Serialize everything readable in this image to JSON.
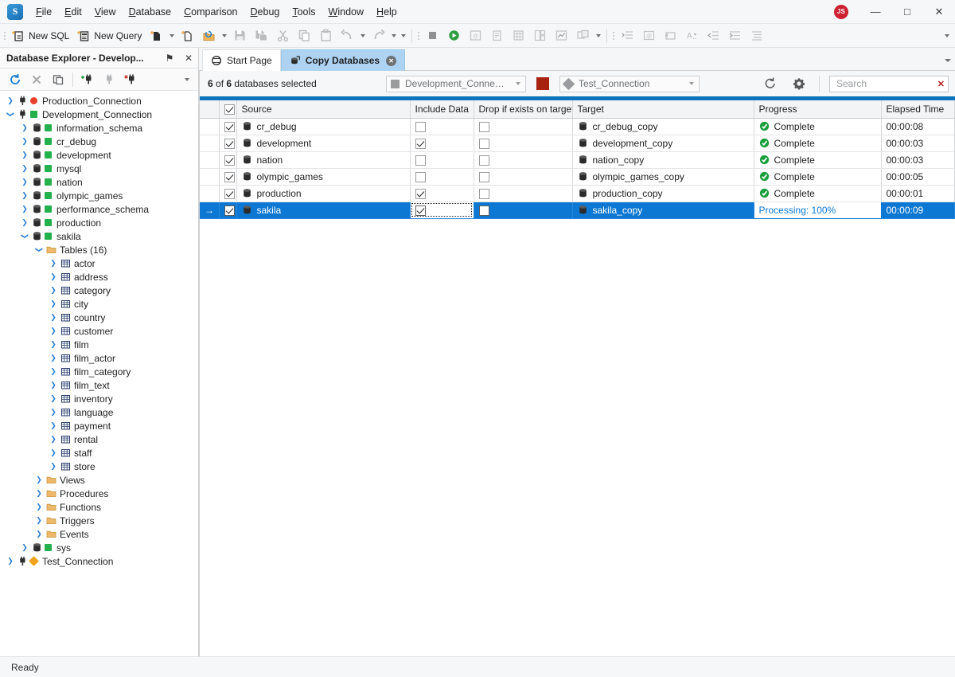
{
  "window": {
    "logo_text": "S",
    "avatar_initials": "JS",
    "minimize_label": "—",
    "maximize_label": "□",
    "close_label": "✕"
  },
  "menubar": {
    "items": [
      {
        "label": "File",
        "name": "menu-file"
      },
      {
        "label": "Edit",
        "name": "menu-edit"
      },
      {
        "label": "View",
        "name": "menu-view"
      },
      {
        "label": "Database",
        "name": "menu-database"
      },
      {
        "label": "Comparison",
        "name": "menu-comparison"
      },
      {
        "label": "Debug",
        "name": "menu-debug"
      },
      {
        "label": "Tools",
        "name": "menu-tools"
      },
      {
        "label": "Window",
        "name": "menu-window"
      },
      {
        "label": "Help",
        "name": "menu-help"
      }
    ]
  },
  "toolbar": {
    "new_sql_label": "New SQL",
    "new_query_label": "New Query",
    "icons": [
      "new-sql-icon",
      "new-query-icon",
      "new-document-icon",
      "new-file-icon",
      "open-folder-icon",
      "save-icon",
      "save-all-icon",
      "cut-icon",
      "copy-icon",
      "paste-icon",
      "undo-icon",
      "redo-icon",
      "stop-icon",
      "execute-icon",
      "execute-to-file-icon",
      "script-icon",
      "execute-grid-icon",
      "execute-report-icon",
      "chart-icon",
      "explain-plan-icon",
      "format-sql-icon",
      "comment-icon",
      "uncomment-icon",
      "case-icon",
      "outdent-icon",
      "indent-icon",
      "align-icon"
    ]
  },
  "explorer": {
    "title": "Database Explorer - Develop...",
    "pin_label": "⚑",
    "close_label": "✕",
    "toolbar_icons": [
      "refresh-icon",
      "disconnect-icon",
      "duplicate-icon",
      "new-connection-icon",
      "connection-icon",
      "delete-connection-icon",
      "overflow-icon"
    ],
    "tree": [
      {
        "label": "Production_Connection",
        "indent": 0,
        "twisty": "collapsed",
        "icon": "plug-icon",
        "dot": "#e8402a",
        "dot_shape": "round"
      },
      {
        "label": "Development_Connection",
        "indent": 0,
        "twisty": "expanded",
        "icon": "plug-icon",
        "dot": "#22b14c",
        "dot_shape": "square"
      },
      {
        "label": "information_schema",
        "indent": 1,
        "twisty": "collapsed",
        "icon": "database-icon",
        "dot": "#22b14c",
        "dot_shape": "square"
      },
      {
        "label": "cr_debug",
        "indent": 1,
        "twisty": "collapsed",
        "icon": "database-icon",
        "dot": "#22b14c",
        "dot_shape": "square"
      },
      {
        "label": "development",
        "indent": 1,
        "twisty": "collapsed",
        "icon": "database-icon",
        "dot": "#22b14c",
        "dot_shape": "square"
      },
      {
        "label": "mysql",
        "indent": 1,
        "twisty": "collapsed",
        "icon": "database-icon",
        "dot": "#22b14c",
        "dot_shape": "square"
      },
      {
        "label": "nation",
        "indent": 1,
        "twisty": "collapsed",
        "icon": "database-icon",
        "dot": "#22b14c",
        "dot_shape": "square"
      },
      {
        "label": "olympic_games",
        "indent": 1,
        "twisty": "collapsed",
        "icon": "database-icon",
        "dot": "#22b14c",
        "dot_shape": "square"
      },
      {
        "label": "performance_schema",
        "indent": 1,
        "twisty": "collapsed",
        "icon": "database-icon",
        "dot": "#22b14c",
        "dot_shape": "square"
      },
      {
        "label": "production",
        "indent": 1,
        "twisty": "collapsed",
        "icon": "database-icon",
        "dot": "#22b14c",
        "dot_shape": "square"
      },
      {
        "label": "sakila",
        "indent": 1,
        "twisty": "expanded",
        "icon": "database-icon",
        "dot": "#22b14c",
        "dot_shape": "square"
      },
      {
        "label": "Tables (16)",
        "indent": 2,
        "twisty": "expanded",
        "icon": "folder-icon",
        "dot": null
      },
      {
        "label": "actor",
        "indent": 3,
        "twisty": "collapsed",
        "icon": "table-icon",
        "dot": null
      },
      {
        "label": "address",
        "indent": 3,
        "twisty": "collapsed",
        "icon": "table-icon",
        "dot": null
      },
      {
        "label": "category",
        "indent": 3,
        "twisty": "collapsed",
        "icon": "table-icon",
        "dot": null
      },
      {
        "label": "city",
        "indent": 3,
        "twisty": "collapsed",
        "icon": "table-icon",
        "dot": null
      },
      {
        "label": "country",
        "indent": 3,
        "twisty": "collapsed",
        "icon": "table-icon",
        "dot": null
      },
      {
        "label": "customer",
        "indent": 3,
        "twisty": "collapsed",
        "icon": "table-icon",
        "dot": null
      },
      {
        "label": "film",
        "indent": 3,
        "twisty": "collapsed",
        "icon": "table-icon",
        "dot": null
      },
      {
        "label": "film_actor",
        "indent": 3,
        "twisty": "collapsed",
        "icon": "table-icon",
        "dot": null
      },
      {
        "label": "film_category",
        "indent": 3,
        "twisty": "collapsed",
        "icon": "table-icon",
        "dot": null
      },
      {
        "label": "film_text",
        "indent": 3,
        "twisty": "collapsed",
        "icon": "table-icon",
        "dot": null
      },
      {
        "label": "inventory",
        "indent": 3,
        "twisty": "collapsed",
        "icon": "table-icon",
        "dot": null
      },
      {
        "label": "language",
        "indent": 3,
        "twisty": "collapsed",
        "icon": "table-icon",
        "dot": null
      },
      {
        "label": "payment",
        "indent": 3,
        "twisty": "collapsed",
        "icon": "table-icon",
        "dot": null
      },
      {
        "label": "rental",
        "indent": 3,
        "twisty": "collapsed",
        "icon": "table-icon",
        "dot": null
      },
      {
        "label": "staff",
        "indent": 3,
        "twisty": "collapsed",
        "icon": "table-icon",
        "dot": null
      },
      {
        "label": "store",
        "indent": 3,
        "twisty": "collapsed",
        "icon": "table-icon",
        "dot": null
      },
      {
        "label": "Views",
        "indent": 2,
        "twisty": "collapsed",
        "icon": "folder-icon",
        "dot": null
      },
      {
        "label": "Procedures",
        "indent": 2,
        "twisty": "collapsed",
        "icon": "folder-icon",
        "dot": null
      },
      {
        "label": "Functions",
        "indent": 2,
        "twisty": "collapsed",
        "icon": "folder-icon",
        "dot": null
      },
      {
        "label": "Triggers",
        "indent": 2,
        "twisty": "collapsed",
        "icon": "folder-icon",
        "dot": null
      },
      {
        "label": "Events",
        "indent": 2,
        "twisty": "collapsed",
        "icon": "folder-icon",
        "dot": null
      },
      {
        "label": "sys",
        "indent": 1,
        "twisty": "collapsed",
        "icon": "database-icon",
        "dot": "#22b14c",
        "dot_shape": "square"
      },
      {
        "label": "Test_Connection",
        "indent": 0,
        "twisty": "collapsed",
        "icon": "plug-icon",
        "dot": "#f0a31a",
        "dot_shape": "diamond"
      }
    ]
  },
  "tabs": [
    {
      "label": "Start Page",
      "icon": "start-page-icon",
      "active": false,
      "closable": false
    },
    {
      "label": "Copy Databases",
      "icon": "copy-databases-icon",
      "active": true,
      "closable": true
    }
  ],
  "pane_toolbar": {
    "selection_count": "6",
    "selection_total": "6",
    "selection_prefix": "of",
    "selection_suffix": "databases selected",
    "source_connection": "Development_Connection",
    "target_connection": "Test_Connection",
    "stop_button_name": "stop-button",
    "refresh_label": "refresh-icon",
    "settings_label": "gear-icon",
    "search_placeholder": "Search",
    "search_value": "",
    "search_clear_label": "✕"
  },
  "progress_bar": {
    "percent": 100,
    "color": "#0c73bd"
  },
  "grid": {
    "columns": [
      {
        "key": "indicator",
        "label": ""
      },
      {
        "key": "checked",
        "label": ""
      },
      {
        "key": "source",
        "label": "Source"
      },
      {
        "key": "include_data",
        "label": "Include Data"
      },
      {
        "key": "drop_if_exists",
        "label": "Drop if exists on target"
      },
      {
        "key": "target",
        "label": "Target"
      },
      {
        "key": "progress",
        "label": "Progress"
      },
      {
        "key": "elapsed",
        "label": "Elapsed Time"
      }
    ],
    "header_select_all": true,
    "rows": [
      {
        "indicator": "",
        "checked": true,
        "source": "cr_debug",
        "include_data": false,
        "drop_if_exists": false,
        "target": "cr_debug_copy",
        "progress": "Complete",
        "progress_state": "complete",
        "elapsed": "00:00:08",
        "selected": false
      },
      {
        "indicator": "",
        "checked": true,
        "source": "development",
        "include_data": true,
        "drop_if_exists": false,
        "target": "development_copy",
        "progress": "Complete",
        "progress_state": "complete",
        "elapsed": "00:00:03",
        "selected": false
      },
      {
        "indicator": "",
        "checked": true,
        "source": "nation",
        "include_data": false,
        "drop_if_exists": false,
        "target": "nation_copy",
        "progress": "Complete",
        "progress_state": "complete",
        "elapsed": "00:00:03",
        "selected": false
      },
      {
        "indicator": "",
        "checked": true,
        "source": "olympic_games",
        "include_data": false,
        "drop_if_exists": false,
        "target": "olympic_games_copy",
        "progress": "Complete",
        "progress_state": "complete",
        "elapsed": "00:00:05",
        "selected": false
      },
      {
        "indicator": "",
        "checked": true,
        "source": "production",
        "include_data": true,
        "drop_if_exists": false,
        "target": "production_copy",
        "progress": "Complete",
        "progress_state": "complete",
        "elapsed": "00:00:01",
        "selected": false
      },
      {
        "indicator": "→",
        "checked": true,
        "source": "sakila",
        "include_data": true,
        "drop_if_exists": false,
        "target": "sakila_copy",
        "progress": "Processing: 100%",
        "progress_state": "processing",
        "elapsed": "00:00:09",
        "selected": true
      }
    ]
  },
  "statusbar": {
    "text": "Ready"
  },
  "colors": {
    "accent": "#0c78d4",
    "progress": "#0c73bd",
    "tab_active": "#aed3f2",
    "status_ok": "#22b14c",
    "status_error": "#e8402a",
    "status_warn": "#f0a31a",
    "stop_red": "#a82210"
  }
}
